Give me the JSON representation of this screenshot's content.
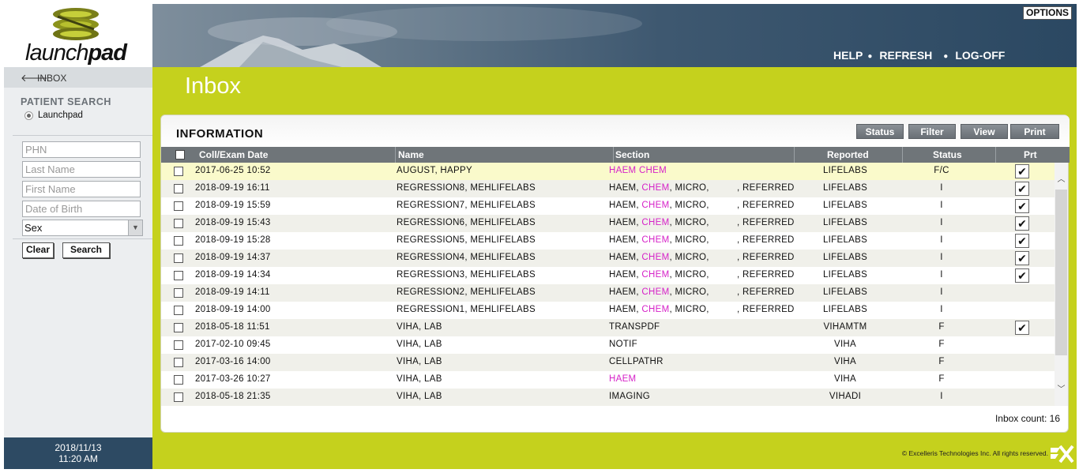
{
  "sidebar": {
    "logo_prefix": "launch",
    "logo_suffix": "pad",
    "back_label": "INBOX",
    "search_title": "PATIENT SEARCH",
    "radio_label": "Launchpad",
    "fields": {
      "phn": "PHN",
      "last_name": "Last Name",
      "first_name": "First Name",
      "dob": "Date of Birth"
    },
    "sex_value": "Sex",
    "clear_label": "Clear",
    "search_label": "Search",
    "date": "2018/11/13",
    "time": "11:20 AM"
  },
  "header": {
    "options_label": "OPTIONS",
    "help_label": "HELP",
    "refresh_label": "REFRESH",
    "logoff_label": "LOG-OFF"
  },
  "page_title": "Inbox",
  "panel": {
    "title": "INFORMATION",
    "buttons": [
      "Status",
      "Filter",
      "View",
      "Print"
    ],
    "columns": {
      "date": "Coll/Exam Date",
      "name": "Name",
      "section": "Section",
      "reported": "Reported",
      "status": "Status",
      "prt": "Prt"
    },
    "inbox_count": "Inbox count: 16"
  },
  "rows": [
    {
      "date": "2017-06-25 10:52",
      "name": "AUGUST, HAPPY",
      "s1": "HAEM",
      "s2": "CHEM",
      "s3": "",
      "s4": "",
      "reported": "LIFELABS",
      "status": "F/C",
      "prt": true,
      "selected": true
    },
    {
      "date": "2018-09-19 16:11",
      "name": "REGRESSION8, MEHLIFELABS",
      "s1": "HAEM,",
      "s2": "CHEM",
      "s3": ", MICRO,",
      "s4": ", REFERRED",
      "reported": "LIFELABS",
      "status": "I",
      "prt": true
    },
    {
      "date": "2018-09-19 15:59",
      "name": "REGRESSION7, MEHLIFELABS",
      "s1": "HAEM,",
      "s2": "CHEM",
      "s3": ", MICRO,",
      "s4": ", REFERRED",
      "reported": "LIFELABS",
      "status": "I",
      "prt": true
    },
    {
      "date": "2018-09-19 15:43",
      "name": "REGRESSION6, MEHLIFELABS",
      "s1": "HAEM,",
      "s2": "CHEM",
      "s3": ", MICRO,",
      "s4": ", REFERRED",
      "reported": "LIFELABS",
      "status": "I",
      "prt": true
    },
    {
      "date": "2018-09-19 15:28",
      "name": "REGRESSION5, MEHLIFELABS",
      "s1": "HAEM,",
      "s2": "CHEM",
      "s3": ", MICRO,",
      "s4": ", REFERRED",
      "reported": "LIFELABS",
      "status": "I",
      "prt": true
    },
    {
      "date": "2018-09-19 14:37",
      "name": "REGRESSION4, MEHLIFELABS",
      "s1": "HAEM,",
      "s2": "CHEM",
      "s3": ", MICRO,",
      "s4": ", REFERRED",
      "reported": "LIFELABS",
      "status": "I",
      "prt": true
    },
    {
      "date": "2018-09-19 14:34",
      "name": "REGRESSION3, MEHLIFELABS",
      "s1": "HAEM,",
      "s2": "CHEM",
      "s3": ", MICRO,",
      "s4": ", REFERRED",
      "reported": "LIFELABS",
      "status": "I",
      "prt": true
    },
    {
      "date": "2018-09-19 14:11",
      "name": "REGRESSION2, MEHLIFELABS",
      "s1": "HAEM,",
      "s2": "CHEM",
      "s3": ", MICRO,",
      "s4": ", REFERRED",
      "reported": "LIFELABS",
      "status": "I",
      "prt": false
    },
    {
      "date": "2018-09-19 14:00",
      "name": "REGRESSION1, MEHLIFELABS",
      "s1": "HAEM,",
      "s2": "CHEM",
      "s3": ", MICRO,",
      "s4": ", REFERRED",
      "reported": "LIFELABS",
      "status": "I",
      "prt": false
    },
    {
      "date": "2018-05-18 11:51",
      "name": "VIHA, LAB",
      "s1": "TRANSPDF",
      "s2": "",
      "s3": "",
      "s4": "",
      "reported": "VIHAMTM",
      "status": "F",
      "prt": true
    },
    {
      "date": "2017-02-10 09:45",
      "name": "VIHA, LAB",
      "s1": "NOTIF",
      "s2": "",
      "s3": "",
      "s4": "",
      "reported": "VIHA",
      "status": "F",
      "prt": false
    },
    {
      "date": "2017-03-16 14:00",
      "name": "VIHA, LAB",
      "s1": "CELLPATHR",
      "s2": "",
      "s3": "",
      "s4": "",
      "reported": "VIHA",
      "status": "F",
      "prt": false
    },
    {
      "date": "2017-03-26 10:27",
      "name": "VIHA, LAB",
      "s1": "",
      "s2": "HAEM",
      "s3": "",
      "s4": "",
      "reported": "VIHA",
      "status": "F",
      "prt": false
    },
    {
      "date": "2018-05-18 21:35",
      "name": "VIHA, LAB",
      "s1": "IMAGING",
      "s2": "",
      "s3": "",
      "s4": "",
      "reported": "VIHADI",
      "status": "I",
      "prt": false
    }
  ],
  "footer": {
    "copyright": "© Excelleris Technologies Inc. All rights reserved."
  },
  "colors": {
    "accent_green": "#c5d11d",
    "header_blue": "#2d4a63",
    "section_pink": "#d622c8"
  }
}
